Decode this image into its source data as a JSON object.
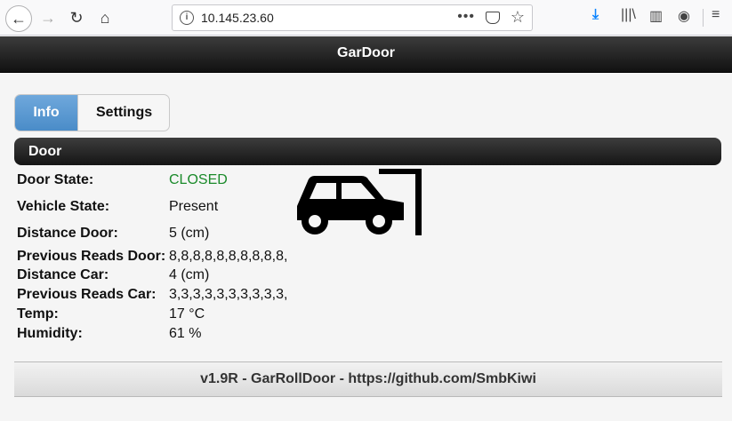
{
  "browser": {
    "url": "10.145.23.60",
    "url_menu_dots": "•••"
  },
  "app": {
    "title": "GarDoor"
  },
  "tabs": [
    {
      "label": "Info",
      "active": true
    },
    {
      "label": "Settings",
      "active": false
    }
  ],
  "section": {
    "title": "Door"
  },
  "info": [
    {
      "label": "Door State:",
      "value": "CLOSED"
    },
    {
      "label": "Vehicle State:",
      "value": "Present"
    },
    {
      "label": "Distance Door:",
      "value": "5 (cm)"
    },
    {
      "label": "Previous Reads Door:",
      "value": "8,8,8,8,8,8,8,8,8,8,"
    },
    {
      "label": "Distance Car:",
      "value": "4 (cm)"
    },
    {
      "label": "Previous Reads Car:",
      "value": "3,3,3,3,3,3,3,3,3,3,"
    },
    {
      "label": "Temp:",
      "value": "17 °C"
    },
    {
      "label": "Humidity:",
      "value": "61 %"
    }
  ],
  "footer": {
    "text": "v1.9R - GarRollDoor - https://github.com/SmbKiwi"
  },
  "colors": {
    "closed_state": "#1a8a2a",
    "tab_active": "#4a8cc8",
    "download_icon": "#0a84ff"
  }
}
